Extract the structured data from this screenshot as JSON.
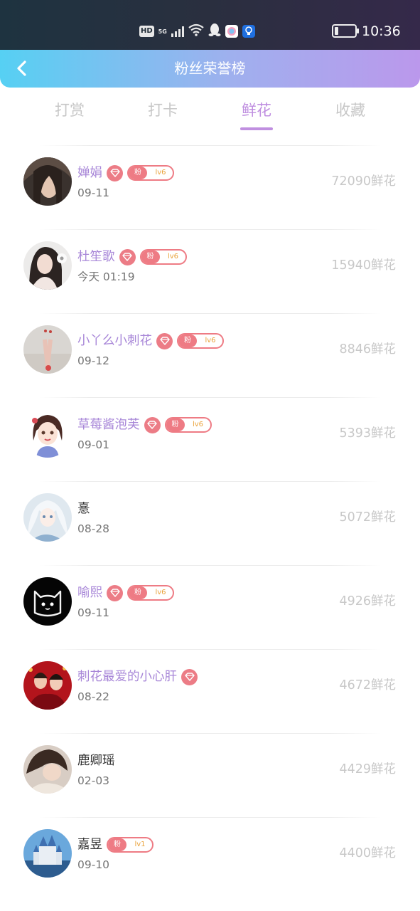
{
  "status_bar": {
    "hd": "HD",
    "network": "5G",
    "time": "10:36",
    "battery_level": 0.2,
    "app_icons": [
      "qq-icon",
      "app-icon",
      "lightbulb-app-icon"
    ]
  },
  "header": {
    "title": "粉丝荣誉榜",
    "background_gradient": [
      "#56d0f3",
      "#bb98ec"
    ]
  },
  "tabs": [
    {
      "label": "打赏",
      "active": false
    },
    {
      "label": "打卡",
      "active": false
    },
    {
      "label": "鲜花",
      "active": true
    },
    {
      "label": "收藏",
      "active": false
    }
  ],
  "colors": {
    "accent": "#c08fe0",
    "name_purple": "#a887d8",
    "badge_red": "#ee7b84",
    "level_orange": "#e9a23a"
  },
  "ranking": [
    {
      "name": "婵娟",
      "date": "09-11",
      "count": "72090鲜花",
      "vip": true,
      "fan_label": "粉",
      "fan_level": "lv6"
    },
    {
      "name": "杜笙歌",
      "date": "今天 01:19",
      "count": "15940鲜花",
      "vip": true,
      "fan_label": "粉",
      "fan_level": "lv6"
    },
    {
      "name": "小丫么小刺花",
      "date": "09-12",
      "count": "8846鲜花",
      "vip": true,
      "fan_label": "粉",
      "fan_level": "lv6"
    },
    {
      "name": "草莓酱泡芙",
      "date": "09-01",
      "count": "5393鲜花",
      "vip": true,
      "fan_label": "粉",
      "fan_level": "lv6"
    },
    {
      "name": "憙",
      "date": "08-28",
      "count": "5072鲜花",
      "vip": false,
      "fan_label": null,
      "fan_level": null
    },
    {
      "name": "喻熙",
      "date": "09-11",
      "count": "4926鲜花",
      "vip": true,
      "fan_label": "粉",
      "fan_level": "lv6"
    },
    {
      "name": "刺花最爱的小心肝",
      "date": "08-22",
      "count": "4672鲜花",
      "vip": true,
      "fan_label": null,
      "fan_level": null
    },
    {
      "name": "鹿卿瑶",
      "date": "02-03",
      "count": "4429鲜花",
      "vip": false,
      "fan_label": null,
      "fan_level": null
    },
    {
      "name": "嘉昱",
      "date": "09-10",
      "count": "4400鲜花",
      "vip": false,
      "fan_label": "粉",
      "fan_level": "lv1"
    }
  ]
}
